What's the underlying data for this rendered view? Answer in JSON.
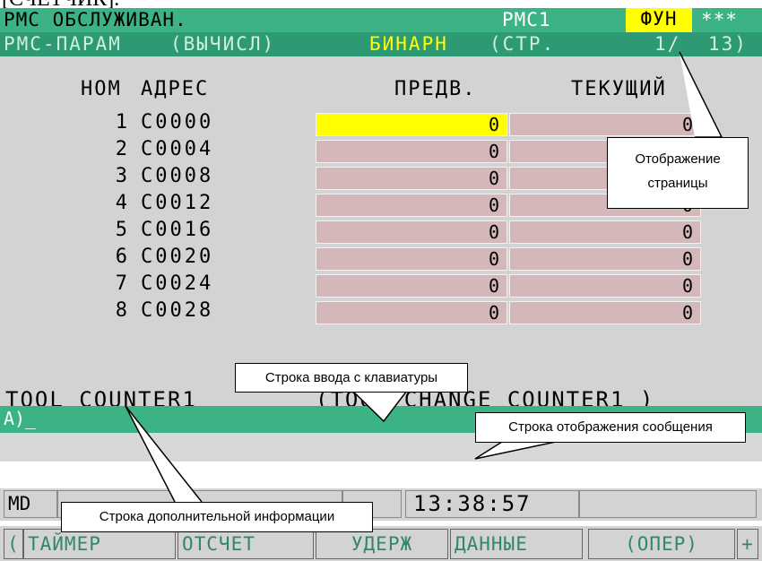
{
  "header": {
    "top_text": "[СЧЕТЧИК].",
    "screen_title": "РМС ОБСЛУЖИВАН.",
    "pmc_label": "РМС1",
    "func_label": "ФУН",
    "alarm_label": "***",
    "subtitle_param": "РМС-ПАРАМ",
    "subtitle_mode": "(ВЫЧИСЛ)",
    "subtitle_binary": "БИНАРН",
    "subtitle_page": "(СТР.",
    "subtitle_page_num": "1/",
    "subtitle_page_total": "13)"
  },
  "table": {
    "col_no": "НОМ",
    "col_addr": "АДРЕС",
    "col_preset": "ПРЕДВ.",
    "col_current": "ТЕКУЩИЙ",
    "rows": [
      {
        "no": "1",
        "addr": "C0000",
        "preset": "0",
        "current": "0"
      },
      {
        "no": "2",
        "addr": "C0004",
        "preset": "0",
        "current": "0"
      },
      {
        "no": "3",
        "addr": "C0008",
        "preset": "0",
        "current": "0"
      },
      {
        "no": "4",
        "addr": "C0012",
        "preset": "0",
        "current": "0"
      },
      {
        "no": "5",
        "addr": "C0016",
        "preset": "0",
        "current": "0"
      },
      {
        "no": "6",
        "addr": "C0020",
        "preset": "0",
        "current": "0"
      },
      {
        "no": "7",
        "addr": "C0024",
        "preset": "0",
        "current": "0"
      },
      {
        "no": "8",
        "addr": "C0028",
        "preset": "0",
        "current": "0"
      }
    ]
  },
  "info_line": {
    "symbol": "TOOL_COUNTER1",
    "comment": "(TOOL CHANGE COUNTER1 )"
  },
  "input_line": {
    "prompt": "A)_"
  },
  "status": {
    "mode": "MD",
    "time": "13:38:57"
  },
  "softkeys": [
    {
      "label": "("
    },
    {
      "label": "ТАЙМЕР"
    },
    {
      "label": "ОТСЧЕТ"
    },
    {
      "label": "УДЕРЖ"
    },
    {
      "label": "ДАННЫЕ"
    },
    {
      "label": "(ОПЕР)"
    },
    {
      "label": "+"
    }
  ],
  "callouts": {
    "page_display_1": "Отображение",
    "page_display_2": "страницы",
    "key_input": "Строка ввода с клавиатуры",
    "message": "Строка отображения сообщения",
    "extra_info": "Строка дополнительной информации"
  },
  "colors": {
    "title_bar": "#3cb384",
    "subtitle_bar": "#2e9a74",
    "cell": "#d4b8b9",
    "cursor_cell": "#ffff00",
    "screen_bg": "#d3d3d3"
  }
}
